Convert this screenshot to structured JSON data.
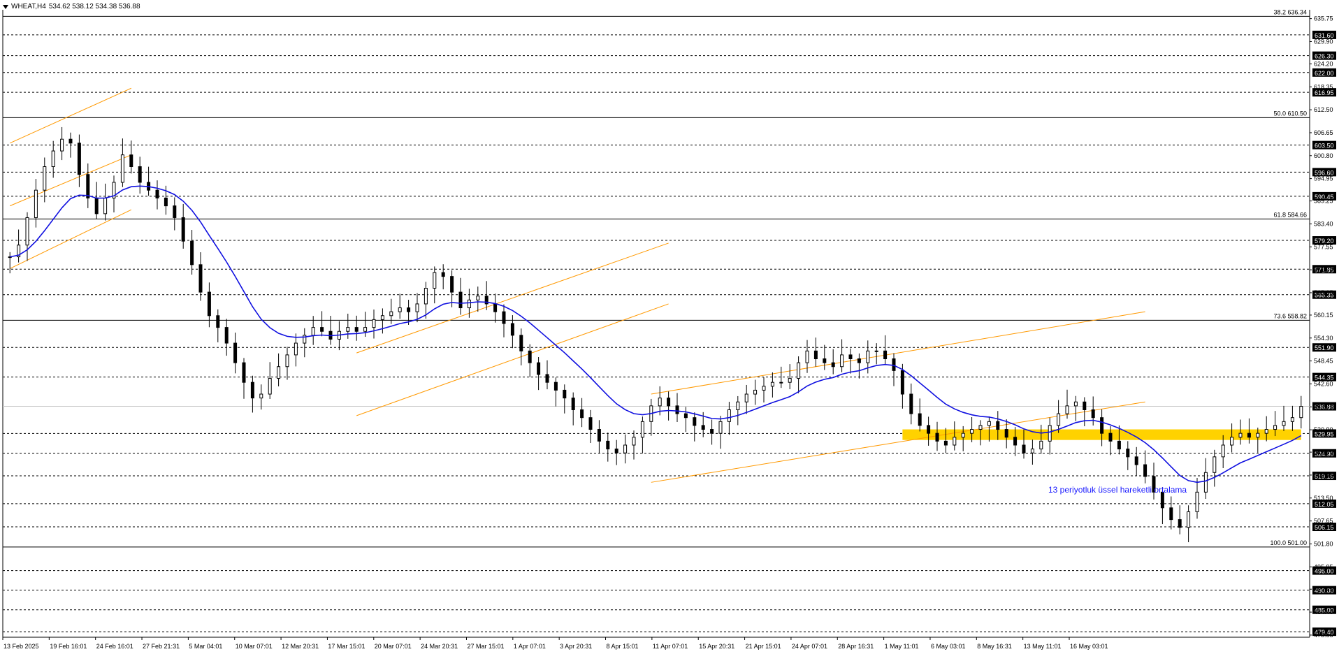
{
  "header": {
    "symbol": "WHEAT,H4",
    "ohlc": "534.62 538.12 534.38 536.88"
  },
  "annotation": {
    "text": "13 periyotluk üssel hareketli ortalama",
    "color": "#1a1aff"
  },
  "colors": {
    "ema": "#1010e0",
    "channel": "#ff9900",
    "zone": "#ffd200",
    "candle": "#000000",
    "grid": "#000000"
  },
  "chart_data": {
    "type": "candlestick",
    "y_axis": {
      "min": 478.0,
      "max": 638.0
    },
    "y_ticks": [
      "635.75",
      "629.90",
      "624.20",
      "618.35",
      "612.50",
      "606.65",
      "600.80",
      "594.95",
      "589.25",
      "583.40",
      "577.55",
      "571.70",
      "565.85",
      "560.15",
      "554.30",
      "548.45",
      "542.60",
      "536.75",
      "530.90",
      "525.20",
      "519.35",
      "513.50",
      "507.65",
      "501.80",
      "495.95",
      "490.25",
      "484.40",
      "478.55"
    ],
    "x_labels": [
      "13 Feb 2025",
      "19 Feb 16:01",
      "24 Feb 16:01",
      "27 Feb 21:31",
      "5 Mar 04:01",
      "10 Mar 07:01",
      "12 Mar 20:31",
      "17 Mar 15:01",
      "20 Mar 07:01",
      "24 Mar 20:31",
      "27 Mar 15:01",
      "1 Apr 07:01",
      "3 Apr 20:31",
      "8 Apr 15:01",
      "11 Apr 07:01",
      "15 Apr 20:31",
      "21 Apr 15:01",
      "24 Apr 07:01",
      "28 Apr 16:31",
      "1 May 11:01",
      "6 May 03:01",
      "8 May 16:31",
      "13 May 11:01",
      "16 May 03:01"
    ],
    "levels": [
      {
        "price": 636.34,
        "label": "38.2 636.34",
        "style": "solid"
      },
      {
        "price": 631.6,
        "label": "631.60",
        "style": "dashed"
      },
      {
        "price": 626.3,
        "label": "626.30",
        "style": "dashed"
      },
      {
        "price": 622.0,
        "label": "622.00",
        "style": "dashed"
      },
      {
        "price": 616.95,
        "label": "616.95",
        "style": "dashed"
      },
      {
        "price": 610.5,
        "label": "50.0 610.50",
        "style": "solid"
      },
      {
        "price": 603.5,
        "label": "603.50",
        "style": "dashed"
      },
      {
        "price": 596.6,
        "label": "596.60",
        "style": "dashed"
      },
      {
        "price": 590.45,
        "label": "590.45",
        "style": "dashed"
      },
      {
        "price": 584.66,
        "label": "61.8 584.66",
        "style": "solid"
      },
      {
        "price": 579.2,
        "label": "579.20",
        "style": "dashed"
      },
      {
        "price": 571.85,
        "label": "571.85",
        "style": "dashed"
      },
      {
        "price": 565.35,
        "label": "565.35",
        "style": "dashed"
      },
      {
        "price": 558.82,
        "label": "73.6 558.82",
        "style": "solid"
      },
      {
        "price": 551.9,
        "label": "551.90",
        "style": "dashed"
      },
      {
        "price": 544.35,
        "label": "544.35",
        "style": "dashed"
      },
      {
        "price": 536.88,
        "label": "536.88",
        "style": "current"
      },
      {
        "price": 529.95,
        "label": "529.95",
        "style": "dashed"
      },
      {
        "price": 524.9,
        "label": "524.90",
        "style": "dashed"
      },
      {
        "price": 519.15,
        "label": "519.15",
        "style": "dashed"
      },
      {
        "price": 512.05,
        "label": "512.05",
        "style": "dashed"
      },
      {
        "price": 506.15,
        "label": "506.15",
        "style": "dashed"
      },
      {
        "price": 501.0,
        "label": "100.0 501.00",
        "style": "solid"
      },
      {
        "price": 495.0,
        "label": "495.00",
        "style": "dashed"
      },
      {
        "price": 490.0,
        "label": "490.00",
        "style": "dashed"
      },
      {
        "price": 485.0,
        "label": "485.00",
        "style": "dashed"
      },
      {
        "price": 479.4,
        "label": "479.40",
        "style": "dashed"
      }
    ],
    "closes": [
      575,
      578,
      585,
      592,
      598,
      602,
      605,
      604,
      596,
      590,
      586,
      590,
      594,
      601,
      598,
      594,
      592,
      590,
      588,
      585,
      579,
      573,
      566,
      560,
      557,
      553,
      548,
      543,
      539,
      540,
      544,
      547,
      550,
      553,
      555,
      557,
      556,
      554,
      556,
      557,
      556,
      557,
      559,
      560,
      561,
      562,
      561,
      563,
      567,
      571,
      570,
      566,
      562,
      564,
      565,
      563,
      561,
      558,
      555,
      551,
      548,
      545,
      543,
      541,
      539,
      536,
      534,
      531,
      528,
      526,
      525,
      527,
      529,
      533,
      537,
      539,
      537,
      535,
      534,
      532,
      531,
      530,
      533,
      536,
      538,
      540,
      541,
      542,
      543,
      543,
      544,
      548,
      551,
      549,
      548,
      547,
      550,
      549,
      548,
      551,
      551,
      549,
      546,
      540,
      535,
      532,
      530,
      528,
      527,
      529,
      530,
      531,
      532,
      533,
      531,
      529,
      527,
      525,
      526,
      528,
      532,
      535,
      537,
      538,
      536,
      534,
      530,
      528,
      526,
      524,
      522,
      519,
      515,
      511,
      508,
      506,
      510,
      515,
      520,
      524,
      527,
      529,
      530,
      529,
      530,
      531,
      532,
      533,
      534,
      536.88
    ],
    "series": [
      {
        "name": "13 periyotluk üssel hareketli ortalama",
        "type": "ema",
        "period": 13
      }
    ],
    "zone": {
      "from_price": 528.3,
      "to_price": 531.0,
      "from_bar": 103,
      "to_bar": 149
    },
    "channels": [
      {
        "from": {
          "bar": 0,
          "price": 604.0
        },
        "to": {
          "bar": 14,
          "price": 618.0
        }
      },
      {
        "from": {
          "bar": 0,
          "price": 588.0
        },
        "to": {
          "bar": 14,
          "price": 601.0
        }
      },
      {
        "from": {
          "bar": 0,
          "price": 572.0
        },
        "to": {
          "bar": 14,
          "price": 587.0
        }
      },
      {
        "from": {
          "bar": 40,
          "price": 550.5
        },
        "to": {
          "bar": 76,
          "price": 578.5
        }
      },
      {
        "from": {
          "bar": 40,
          "price": 534.5
        },
        "to": {
          "bar": 76,
          "price": 563.0
        }
      },
      {
        "from": {
          "bar": 74,
          "price": 540.0
        },
        "to": {
          "bar": 131,
          "price": 561.0
        }
      },
      {
        "from": {
          "bar": 74,
          "price": 517.5
        },
        "to": {
          "bar": 131,
          "price": 538.0
        }
      }
    ]
  }
}
